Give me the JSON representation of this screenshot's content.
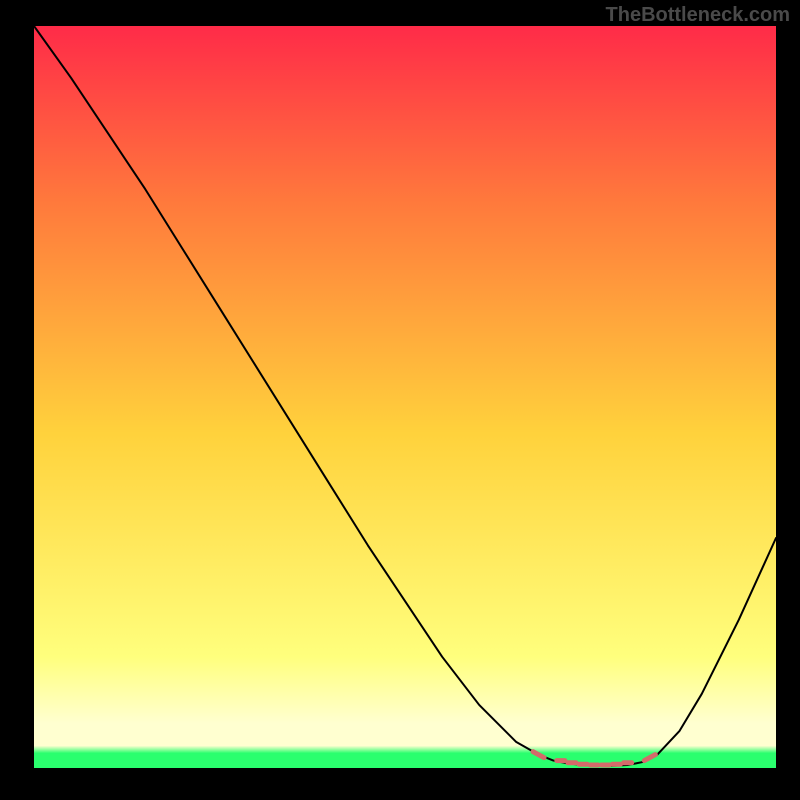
{
  "watermark": "TheBottleneck.com",
  "chart_data": {
    "type": "line",
    "title": "",
    "xlabel": "",
    "ylabel": "",
    "xlim": [
      0,
      1
    ],
    "ylim": [
      0,
      1
    ],
    "background_gradient": {
      "top": "#ff2b48",
      "mid_upper": "#ff7a3c",
      "mid": "#ffd23c",
      "mid_lower": "#ffff7d",
      "bottom_band": "#ffffd0",
      "bottom": "#2aff6e"
    },
    "series": [
      {
        "name": "curve",
        "color": "#000000",
        "stroke_width": 2,
        "x": [
          0.0,
          0.05,
          0.1,
          0.15,
          0.2,
          0.25,
          0.3,
          0.35,
          0.4,
          0.45,
          0.5,
          0.55,
          0.6,
          0.65,
          0.68,
          0.7,
          0.72,
          0.74,
          0.76,
          0.78,
          0.8,
          0.82,
          0.84,
          0.87,
          0.9,
          0.95,
          1.0
        ],
        "values": [
          1.0,
          0.93,
          0.855,
          0.78,
          0.7,
          0.62,
          0.54,
          0.46,
          0.38,
          0.3,
          0.225,
          0.15,
          0.085,
          0.035,
          0.018,
          0.01,
          0.006,
          0.004,
          0.003,
          0.003,
          0.004,
          0.008,
          0.018,
          0.05,
          0.1,
          0.2,
          0.31
        ]
      },
      {
        "name": "valley-marks",
        "color": "#d46a6a",
        "marker": "dash",
        "x": [
          0.68,
          0.71,
          0.725,
          0.74,
          0.755,
          0.77,
          0.785,
          0.8,
          0.83
        ],
        "values": [
          0.018,
          0.01,
          0.007,
          0.005,
          0.004,
          0.004,
          0.005,
          0.007,
          0.014
        ]
      }
    ]
  }
}
